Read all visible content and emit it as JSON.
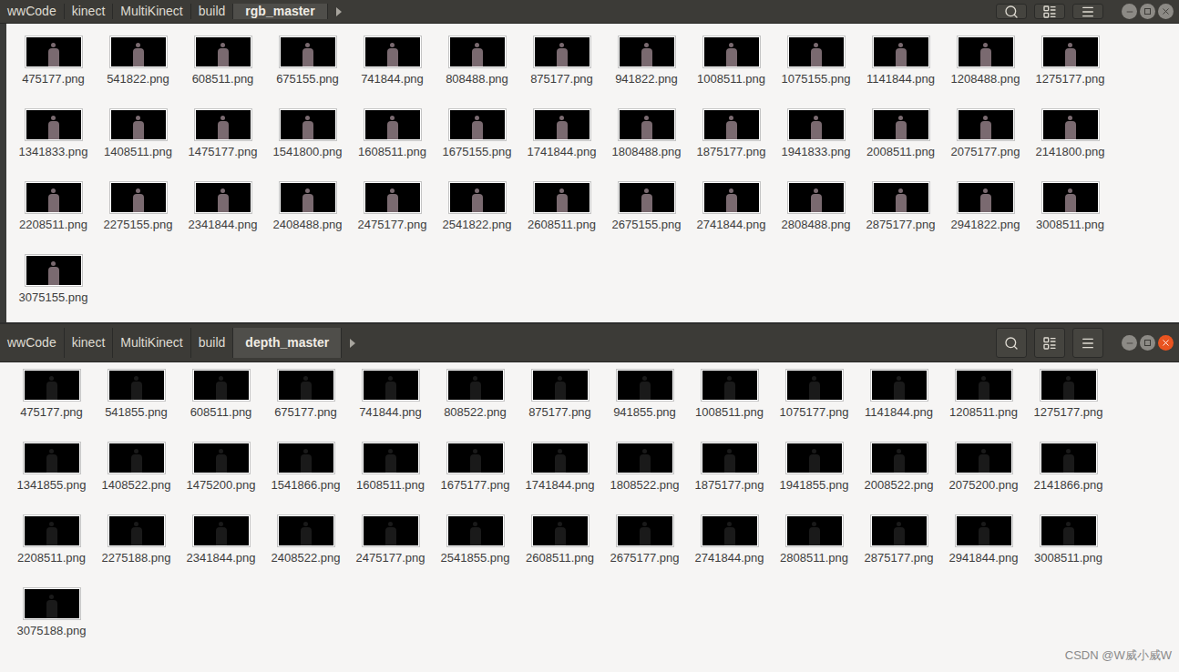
{
  "windows": [
    {
      "active": false,
      "thumbnail": "rgb",
      "path": [
        {
          "label": "wwCode",
          "selected": false
        },
        {
          "label": "kinect",
          "selected": false
        },
        {
          "label": "MultiKinect",
          "selected": false
        },
        {
          "label": "build",
          "selected": false
        },
        {
          "label": "rgb_master",
          "selected": true
        }
      ],
      "files": [
        "475177.png",
        "541822.png",
        "608511.png",
        "675155.png",
        "741844.png",
        "808488.png",
        "875177.png",
        "941822.png",
        "1008511.png",
        "1075155.png",
        "1141844.png",
        "1208488.png",
        "1275177.png",
        "1341833.png",
        "1408511.png",
        "1475177.png",
        "1541800.png",
        "1608511.png",
        "1675155.png",
        "1741844.png",
        "1808488.png",
        "1875177.png",
        "1941833.png",
        "2008511.png",
        "2075177.png",
        "2141800.png",
        "2208511.png",
        "2275155.png",
        "2341844.png",
        "2408488.png",
        "2475177.png",
        "2541822.png",
        "2608511.png",
        "2675155.png",
        "2741844.png",
        "2808488.png",
        "2875177.png",
        "2941822.png",
        "3008511.png",
        "3075155.png"
      ]
    },
    {
      "active": true,
      "thumbnail": "depth",
      "path": [
        {
          "label": "wwCode",
          "selected": false
        },
        {
          "label": "kinect",
          "selected": false
        },
        {
          "label": "MultiKinect",
          "selected": false
        },
        {
          "label": "build",
          "selected": false
        },
        {
          "label": "depth_master",
          "selected": true
        }
      ],
      "files": [
        "475177.png",
        "541855.png",
        "608511.png",
        "675177.png",
        "741844.png",
        "808522.png",
        "875177.png",
        "941855.png",
        "1008511.png",
        "1075177.png",
        "1141844.png",
        "1208511.png",
        "1275177.png",
        "1341855.png",
        "1408522.png",
        "1475200.png",
        "1541866.png",
        "1608511.png",
        "1675177.png",
        "1741844.png",
        "1808522.png",
        "1875177.png",
        "1941855.png",
        "2008522.png",
        "2075200.png",
        "2141866.png",
        "2208511.png",
        "2275188.png",
        "2341844.png",
        "2408522.png",
        "2475177.png",
        "2541855.png",
        "2608511.png",
        "2675177.png",
        "2741844.png",
        "2808511.png",
        "2875177.png",
        "2941844.png",
        "3008511.png",
        "3075188.png"
      ]
    }
  ],
  "watermark": "CSDN @W威小威W"
}
